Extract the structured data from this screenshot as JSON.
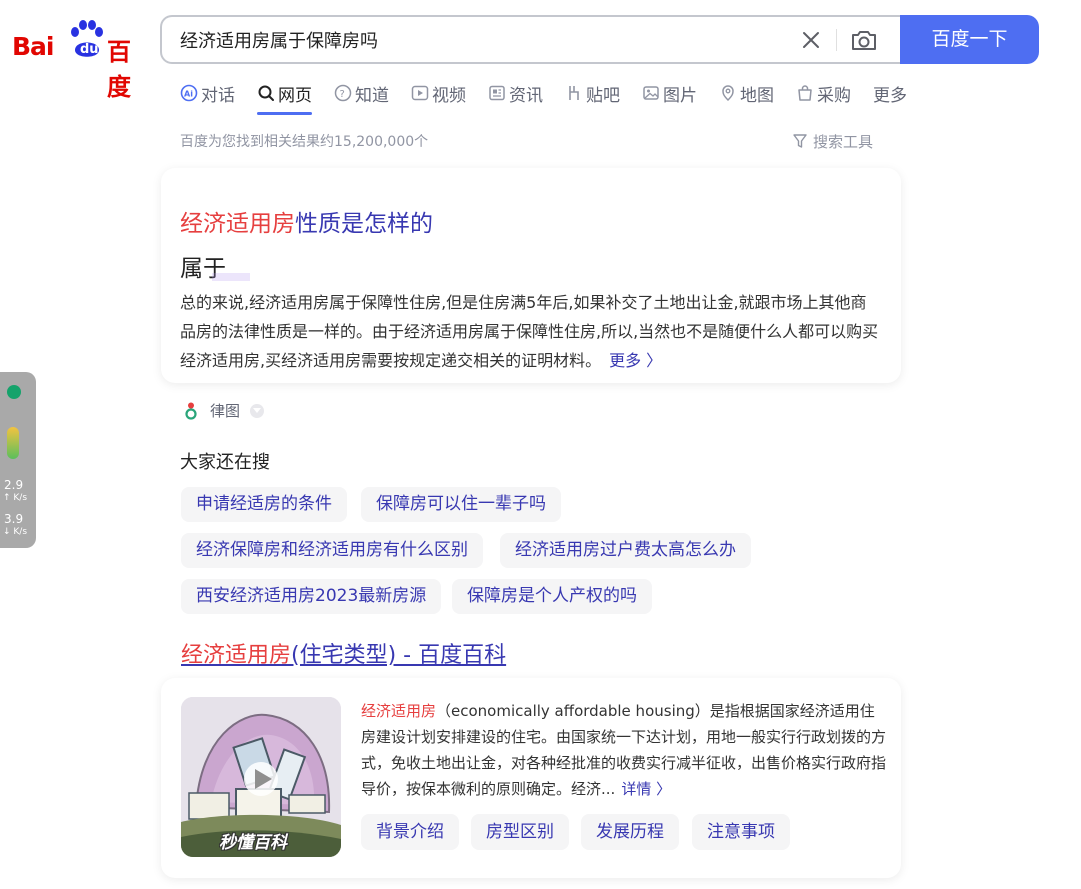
{
  "header": {
    "logo_text_left": "Bai",
    "logo_text_paw": "du",
    "logo_text_right": "百度",
    "search_query": "经济适用房属于保障房吗",
    "search_button": "百度一下"
  },
  "tabs": [
    {
      "label": "对话",
      "icon": "ai-chat-icon",
      "active": false
    },
    {
      "label": "网页",
      "icon": "search-icon",
      "active": true
    },
    {
      "label": "知道",
      "icon": "question-icon",
      "active": false
    },
    {
      "label": "视频",
      "icon": "play-icon",
      "active": false
    },
    {
      "label": "资讯",
      "icon": "news-icon",
      "active": false
    },
    {
      "label": "贴吧",
      "icon": "tieba-icon",
      "active": false
    },
    {
      "label": "图片",
      "icon": "image-icon",
      "active": false
    },
    {
      "label": "地图",
      "icon": "map-icon",
      "active": false
    },
    {
      "label": "采购",
      "icon": "shop-icon",
      "active": false
    },
    {
      "label": "更多",
      "icon": "",
      "active": false
    }
  ],
  "result_count": "百度为您找到相关结果约15,200,000个",
  "search_tools": "搜索工具",
  "answer_card": {
    "title_highlight": "经济适用房",
    "title_rest": "性质是怎样的",
    "answer": "属于",
    "text": "总的来说,经济适用房属于保障性住房,但是住房满5年后,如果补交了土地出让金,就跟市场上其他商品房的法律性质是一样的。由于经济适用房属于保障性住房,所以,当然也不是随便什么人都可以购买经济适用房,买经济适用房需要按规定递交相关的证明材料。",
    "more": "更多 〉",
    "source": "律图"
  },
  "also_search": {
    "title": "大家还在搜",
    "items": [
      "申请经适房的条件",
      "保障房可以住一辈子吗",
      "经济保障房和经济适用房有什么区别",
      "经济适用房过户费太高怎么办",
      "西安经济适用房2023最新房源",
      "保障房是个人产权的吗"
    ]
  },
  "baike": {
    "title_highlight": "经济适用房",
    "title_rest": "(住宅类型) - 百度百科",
    "text_highlight": "经济适用房",
    "text_rest": "（economically affordable housing）是指根据国家经济适用住房建设计划安排建设的住宅。由国家统一下达计划，用地一般实行行政划拨的方式，免收土地出让金，对各种经批准的收费实行减半征收，出售价格实行政府指导价，按保本微利的原则确定。经济...",
    "more": "详情 〉",
    "thumb_caption": "秒懂百科",
    "sub_links": [
      "背景介绍",
      "房型区别",
      "发展历程",
      "注意事项"
    ]
  },
  "widget": {
    "up_value": "2.9",
    "up_unit": "↑ K/s",
    "down_value": "3.9",
    "down_unit": "↓ K/s"
  },
  "colors": {
    "brand_red": "#e10601",
    "brand_blue": "#4e6ef2",
    "link": "#3838b1",
    "highlight": "#e63f3f"
  }
}
